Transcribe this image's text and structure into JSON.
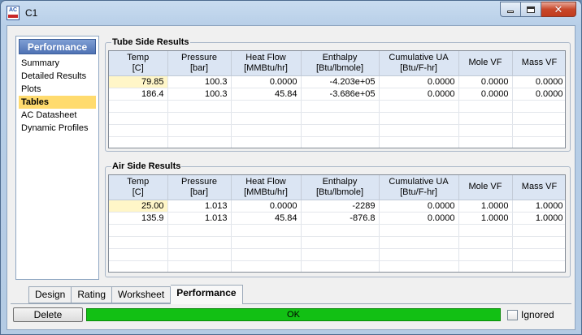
{
  "window": {
    "title": "C1",
    "app_icon_label": "AC"
  },
  "nav": {
    "header": "Performance",
    "items": [
      {
        "label": "Summary",
        "selected": false
      },
      {
        "label": "Detailed Results",
        "selected": false
      },
      {
        "label": "Plots",
        "selected": false
      },
      {
        "label": "Tables",
        "selected": true
      },
      {
        "label": "AC Datasheet",
        "selected": false
      },
      {
        "label": "Dynamic Profiles",
        "selected": false
      }
    ]
  },
  "tube_side": {
    "title": "Tube Side Results",
    "columns": [
      {
        "name": "Temp",
        "unit": "[C]"
      },
      {
        "name": "Pressure",
        "unit": "[bar]"
      },
      {
        "name": "Heat Flow",
        "unit": "[MMBtu/hr]"
      },
      {
        "name": "Enthalpy",
        "unit": "[Btu/lbmole]"
      },
      {
        "name": "Cumulative UA",
        "unit": "[Btu/F-hr]"
      },
      {
        "name": "Mole VF",
        "unit": ""
      },
      {
        "name": "Mass VF",
        "unit": ""
      }
    ],
    "rows": [
      [
        "79.85",
        "100.3",
        "0.0000",
        "-4.203e+05",
        "0.0000",
        "0.0000",
        "0.0000"
      ],
      [
        "186.4",
        "100.3",
        "45.84",
        "-3.686e+05",
        "0.0000",
        "0.0000",
        "0.0000"
      ]
    ]
  },
  "air_side": {
    "title": "Air Side Results",
    "columns": [
      {
        "name": "Temp",
        "unit": "[C]"
      },
      {
        "name": "Pressure",
        "unit": "[bar]"
      },
      {
        "name": "Heat Flow",
        "unit": "[MMBtu/hr]"
      },
      {
        "name": "Enthalpy",
        "unit": "[Btu/lbmole]"
      },
      {
        "name": "Cumulative UA",
        "unit": "[Btu/F-hr]"
      },
      {
        "name": "Mole VF",
        "unit": ""
      },
      {
        "name": "Mass VF",
        "unit": ""
      }
    ],
    "rows": [
      [
        "25.00",
        "1.013",
        "0.0000",
        "-2289",
        "0.0000",
        "1.0000",
        "1.0000"
      ],
      [
        "135.9",
        "1.013",
        "45.84",
        "-876.8",
        "0.0000",
        "1.0000",
        "1.0000"
      ]
    ]
  },
  "tabs": [
    {
      "label": "Design",
      "active": false
    },
    {
      "label": "Rating",
      "active": false
    },
    {
      "label": "Worksheet",
      "active": false
    },
    {
      "label": "Performance",
      "active": true
    }
  ],
  "footer": {
    "delete_label": "Delete",
    "status_text": "OK",
    "status_color": "#12c014",
    "ignored_label": "Ignored",
    "ignored_checked": false
  },
  "colors": {
    "nav_selected": "#ffdb6e",
    "header_bg": "#dbe5f3",
    "highlight_cell": "#fff6c8"
  }
}
